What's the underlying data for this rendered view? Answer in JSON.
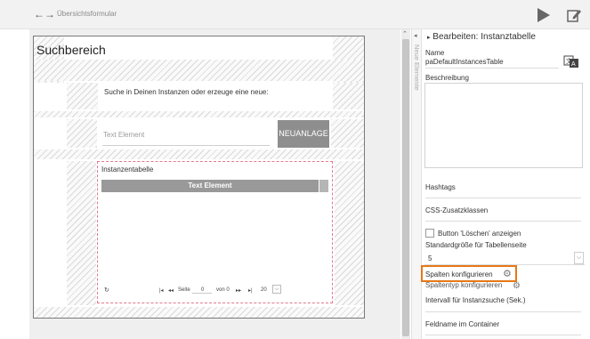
{
  "header": {
    "breadcrumb": "Übersichtsformular",
    "back_icon": "arrow-left-icon",
    "forward_icon": "arrow-right-icon",
    "run_icon": "play-icon",
    "edit_icon": "edit-icon"
  },
  "form": {
    "title": "Suchbereich",
    "instruction": "Suche in Deinen Instanzen oder erzeuge eine neue:",
    "text_field_placeholder": "Text Element",
    "new_button": "NEUANLAGE",
    "table": {
      "label": "Instanzentabelle",
      "column_header": "Text Element",
      "pager": {
        "page_label": "Seite",
        "page_value": "0",
        "of_label": "von 0",
        "page_size": "20"
      }
    }
  },
  "side_tab": {
    "label": "Neue Elemente"
  },
  "properties": {
    "title": "Bearbeiten: Instanztabelle",
    "name_label": "Name",
    "name_value": "paDefaultInstancesTable",
    "description_label": "Beschreibung",
    "hashtags_label": "Hashtags",
    "css_label": "CSS-Zusatzklassen",
    "delete_checkbox_label": "Button 'Löschen' anzeigen",
    "page_size_label": "Standardgröße für Tabellenseite",
    "page_size_value": "5",
    "configure_columns": "Spalten konfigurieren",
    "column_type": "Spaltentyp konfigurieren",
    "interval_label": "Intervall für Instanzsuche (Sek.)",
    "container_field_label": "Feldname im Container"
  },
  "colors": {
    "accent_orange": "#e77817",
    "button_gray": "#8e8e8e",
    "dashed_border": "#e07a8e"
  }
}
